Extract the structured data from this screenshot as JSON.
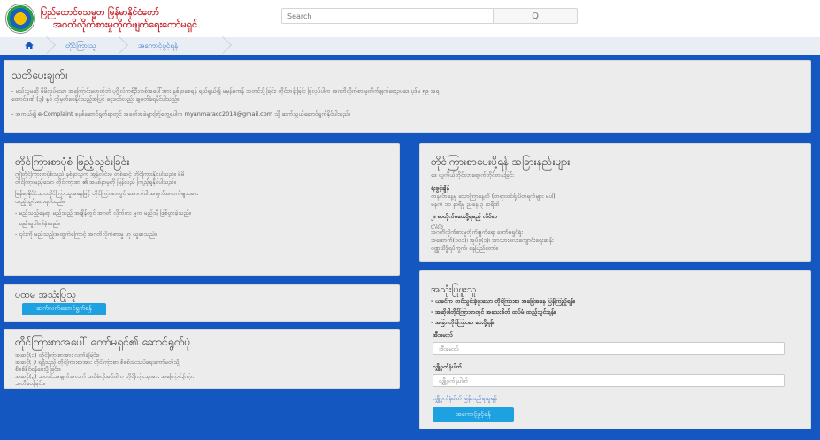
{
  "header": {
    "org_title": "ပြည်ထောင်စုသမ္မတ မြန်မာနိုင်ငံတော်",
    "org_subtitle": "အဂတိလိုက်စားမှုတိုက်ဖျက်ရေးကော်မရှင်",
    "search_placeholder": "Search",
    "search_icon": "Q"
  },
  "breadcrumb": {
    "home_icon": "home-icon",
    "items": [
      "တိုင်ကြားသူ",
      "အကောင့်ဖွင့်ရန်"
    ]
  },
  "notice": {
    "title": "သတိပေးချက်။",
    "line1": "- မည်သူမဆို မိမိလုပ်သော အကြောင်းမဟုတ်ဘဲ ပုဂ္ဂိုလ်ကစ်ဦးကစ်အပေါ်အား နစ်နာစေရန် ရည်ရွယ်၍ မမှန်မကန် သတင်းပို့ခြင်း၊ တိုင်တန်းခြင်း ပြုလုပ်ပါက အဂတိလိုက်စားမှုတိုက်ဖျက်ရေးဥပဒေ ပုဒ်မ ၅၉ အရ",
    "line2": "ထောင်ဒဏ် (၃) နှစ် ထိုမှတ်စေနိုင်သည့်အပြင် ငွေဒဏ်လည်း ချမှတ်ခံရနိုင်ပါသည်။",
    "line3": "- အကယ်၍ e-Complaint စနစ်ဆောင်ရွက်ရာတွင် အခက်အခဲများကြုံတွေ့ရပါက myanmaracc2014@gmail.com သို့ ဆက်သွယ်ဆောင်ရွက်နိုင်ပါသည်။"
  },
  "qualify": {
    "title": "တိုင်ကြားစာပုံစံ ဖြည့်သွင်းခြင်း",
    "lines": [
      "ဤတိုင်ကြားစာပုံစံသည် နစ်နာသူက အွန်လိုင်းမှ တစ်ဆင့် တိုင်ကြားနိုင်ပါသည်။ မိမိ",
      "တိုင်ကြားမည့်သော တိုင်ကြားစာ ၏ အနစ်နာမှုကို မြန်လည် ကြည့်ရှုနိုင်ပါသည်။",
      "မြန်မာနိုင်ငံသားတိုင်ကြားသူအနေဖြင့် တိုင်ကြားစာတွင် အောက်ပါ အချက်အလက်များအား",
      "ထည့်သွင်းပေးရပါသည်။",
      "- မည်သည့်နေရာ မည်သည့် အချိန်တွင် အဂတိ လိုက်စား မှုက မည်သို့ ဖြစ်ပွားခဲ့သည်။",
      "- မည်သူပါဝင်ခဲ့သည်။",
      "- ၎င်းကို မည်သည့်အထွက်ကြောင့် အဂတိလိုက်စားမှု ဟု ယူဆသည်။"
    ]
  },
  "address": {
    "title": "တိုင်ကြားစာပေးပို့ရန် အခြားနည်းများ",
    "subtitle": "ဒေ လူကိုယ်တိုင်လာရောက်တိုင်တန်းခြင်း",
    "label1": "ရုံးဖွင့်ချိန်",
    "line1": "တနင်္လာနေ့မှ သောကြာနေ့ထိ (တရားဝင်ရုံးပိတ်ရက်များ မပါ)",
    "line2": "မနက် ၁၀ နာရီမှ ညနေ ၃ နာရီထိ",
    "label2": "၂။ စာတိုက်မှပေးပို့ရမည့် လိပ်စာ",
    "line3": "ဥက္ကဋ္ဌ",
    "line4": "အဂတိလိုက်စားမှုတိုက်ဖျက်ရေး ကော်မရှင်ရုံး",
    "line5": "အဆောက်(၁၀၁)၊ အုပ်စု(၁)၊ အာသားလေးကျောင်းရှေးဆန်း",
    "line6": "ဝဏ္ဏသိဒ္ဓိရပ်ကွက်၊ နေပြည်တော်။"
  },
  "first_use": {
    "title": "ပထမ အသုံးပြုသူ",
    "button": "ဆက်လက်ဆောင်ရွက်ရန်"
  },
  "steps": {
    "title": "တိုင်ကြားစာအပေါ် ကော်မရှင်၏ ဆောင်ရွက်ပုံ",
    "lines": [
      "အဆင့်(၁) တိုင်ကြားစာအား လက်ခံခြင်း။",
      "အဆင့်(၂) ရရှိသည့် တိုင်ကြားစာအား တိုင်ကြားစာ စိစစ်သုံးသပ်ရေးကော်မတီသို့",
      "စိစစ်နိုင်ရန်ပေးပို့ခြင်း။",
      "အဆင့်(၃) သတင်းအချက်အလက် ထပ်မံလိုအပ်ပါက တိုင်ကြားသူအား အကြောင်းကြား",
      "သတိပေးခြင်း။"
    ]
  },
  "login": {
    "title": "အသုံးပြုဖူးသူ",
    "lines": [
      "- ယခင်က တင်သွင်းခဲ့ဖူးသော တိုင်ကြားစာ အခြေအနေ ပြန်ကြည့်ရန်။",
      "- အဆိုပါတိုင်ကြားစာတွင် အသေးစိတ် ထပ်မံ ထည့်သွင်းရန်။",
      "- အခြားတိုင်ကြားစာ ပေးပို့ရန်။"
    ],
    "email_label": "အီးမေးလ်",
    "email_placeholder": "အီးမေးလ်",
    "password_label": "လျှို့ဝှက်နံပါတ်",
    "password_placeholder": "လျှို့ဝှက်နံပါတ်",
    "forgot": "လျှို့ဝှက်နံပါတ် မြန်လည်ရယူရန်",
    "button": "အကောင့်ဖွင့်ရန်"
  }
}
